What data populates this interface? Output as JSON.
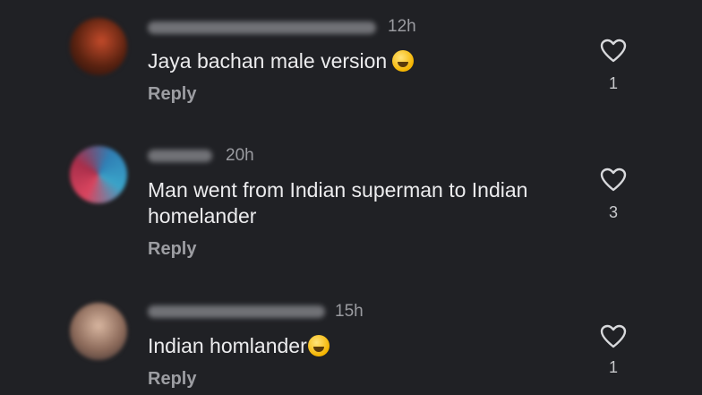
{
  "comments": [
    {
      "time": "12h",
      "text": "Jaya bachan male version",
      "emoji": "tears-of-joy-emoji",
      "reply": "Reply",
      "likes": "1"
    },
    {
      "time": "20h",
      "text": "Man went from Indian superman to Indian homelander",
      "reply": "Reply",
      "likes": "3"
    },
    {
      "time": "15h",
      "text": "Indian homlander",
      "emoji": "rolling-on-floor-laughing-emoji",
      "reply": "Reply",
      "likes": "1"
    }
  ],
  "icons": {
    "like": "heart-icon"
  },
  "colors": {
    "background": "#202125",
    "text": "#ececee",
    "muted": "#9a9ba0"
  }
}
